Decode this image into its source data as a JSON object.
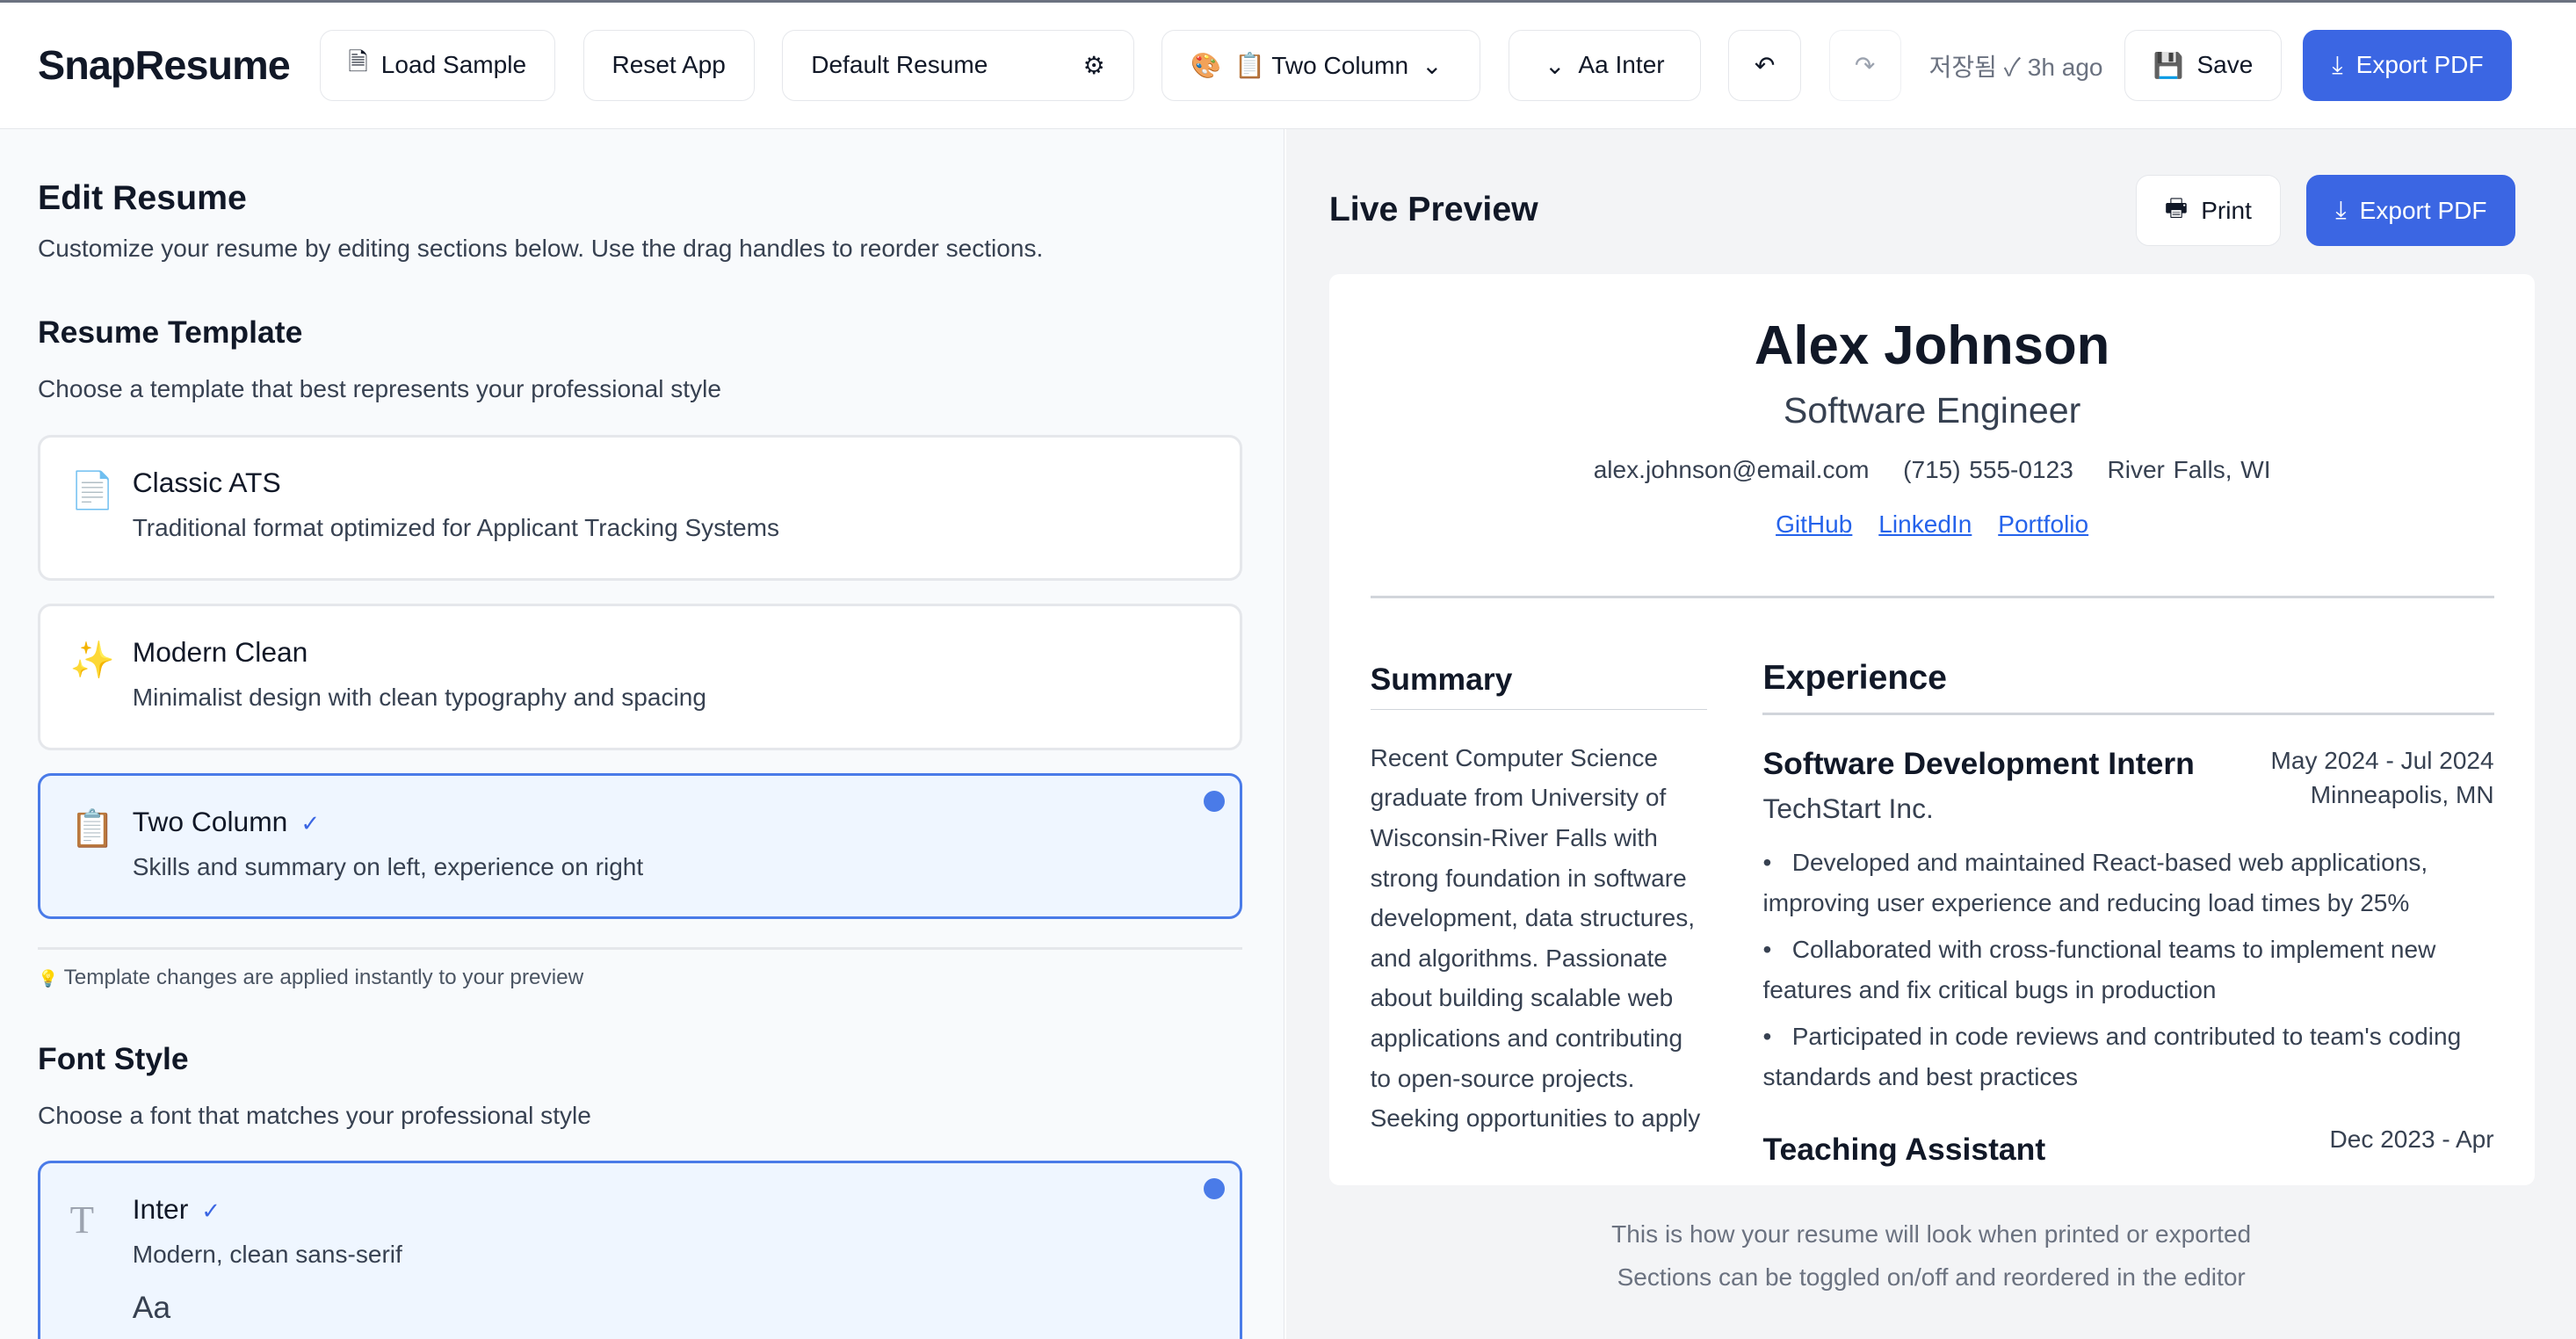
{
  "header": {
    "logo": "SnapResume",
    "load_sample": "Load Sample",
    "reset_app": "Reset App",
    "resume_name": "Default Resume",
    "template_select": "📋 Two Column",
    "font_select": "Aa Inter",
    "saved_status": "저장됨 ✓ 3h ago",
    "save": "Save",
    "export_pdf": "Export PDF"
  },
  "editor": {
    "title": "Edit Resume",
    "description": "Customize your resume by editing sections below. Use the drag handles to reorder sections.",
    "template_section": {
      "title": "Resume Template",
      "description": "Choose a template that best represents your professional style",
      "templates": [
        {
          "icon": "📄",
          "name": "Classic ATS",
          "description": "Traditional format optimized for Applicant Tracking Systems",
          "selected": false
        },
        {
          "icon": "✨",
          "name": "Modern Clean",
          "description": "Minimalist design with clean typography and spacing",
          "selected": false
        },
        {
          "icon": "📋",
          "name": "Two Column",
          "description": "Skills and summary on left, experience on right",
          "selected": true
        }
      ],
      "tip": "Template changes are applied instantly to your preview"
    },
    "font_section": {
      "title": "Font Style",
      "description": "Choose a font that matches your professional style",
      "fonts": [
        {
          "name": "Inter",
          "description": "Modern, clean sans-serif",
          "sample": "Aa",
          "selected": true
        }
      ]
    }
  },
  "preview": {
    "title": "Live Preview",
    "print": "Print",
    "export_pdf": "Export PDF",
    "footer_line1": "This is how your resume will look when printed or exported",
    "footer_line2": "Sections can be toggled on/off and reordered in the editor",
    "resume": {
      "name": "Alex Johnson",
      "title": "Software Engineer",
      "email": "alex.johnson@email.com",
      "phone": "(715) 555-0123",
      "location": "River Falls, WI",
      "links": [
        "GitHub",
        "LinkedIn",
        "Portfolio"
      ],
      "summary_heading": "Summary",
      "summary": "Recent Computer Science graduate from University of Wisconsin-River Falls with strong foundation in software development, data structures, and algorithms. Passionate about building scalable web applications and contributing to open-source projects. Seeking opportunities to apply",
      "experience_heading": "Experience",
      "jobs": [
        {
          "role": "Software Development Intern",
          "company": "TechStart Inc.",
          "dates": "May 2024 - Jul 2024",
          "location": "Minneapolis, MN",
          "bullets": [
            "Developed and maintained React-based web applications, improving user experience and reducing load times by 25%",
            "Collaborated with cross-functional teams to implement new features and fix critical bugs in production",
            "Participated in code reviews and contributed to team's coding standards and best practices"
          ]
        },
        {
          "role": "Teaching Assistant",
          "dates": "Dec 2023 - Apr"
        }
      ]
    }
  }
}
